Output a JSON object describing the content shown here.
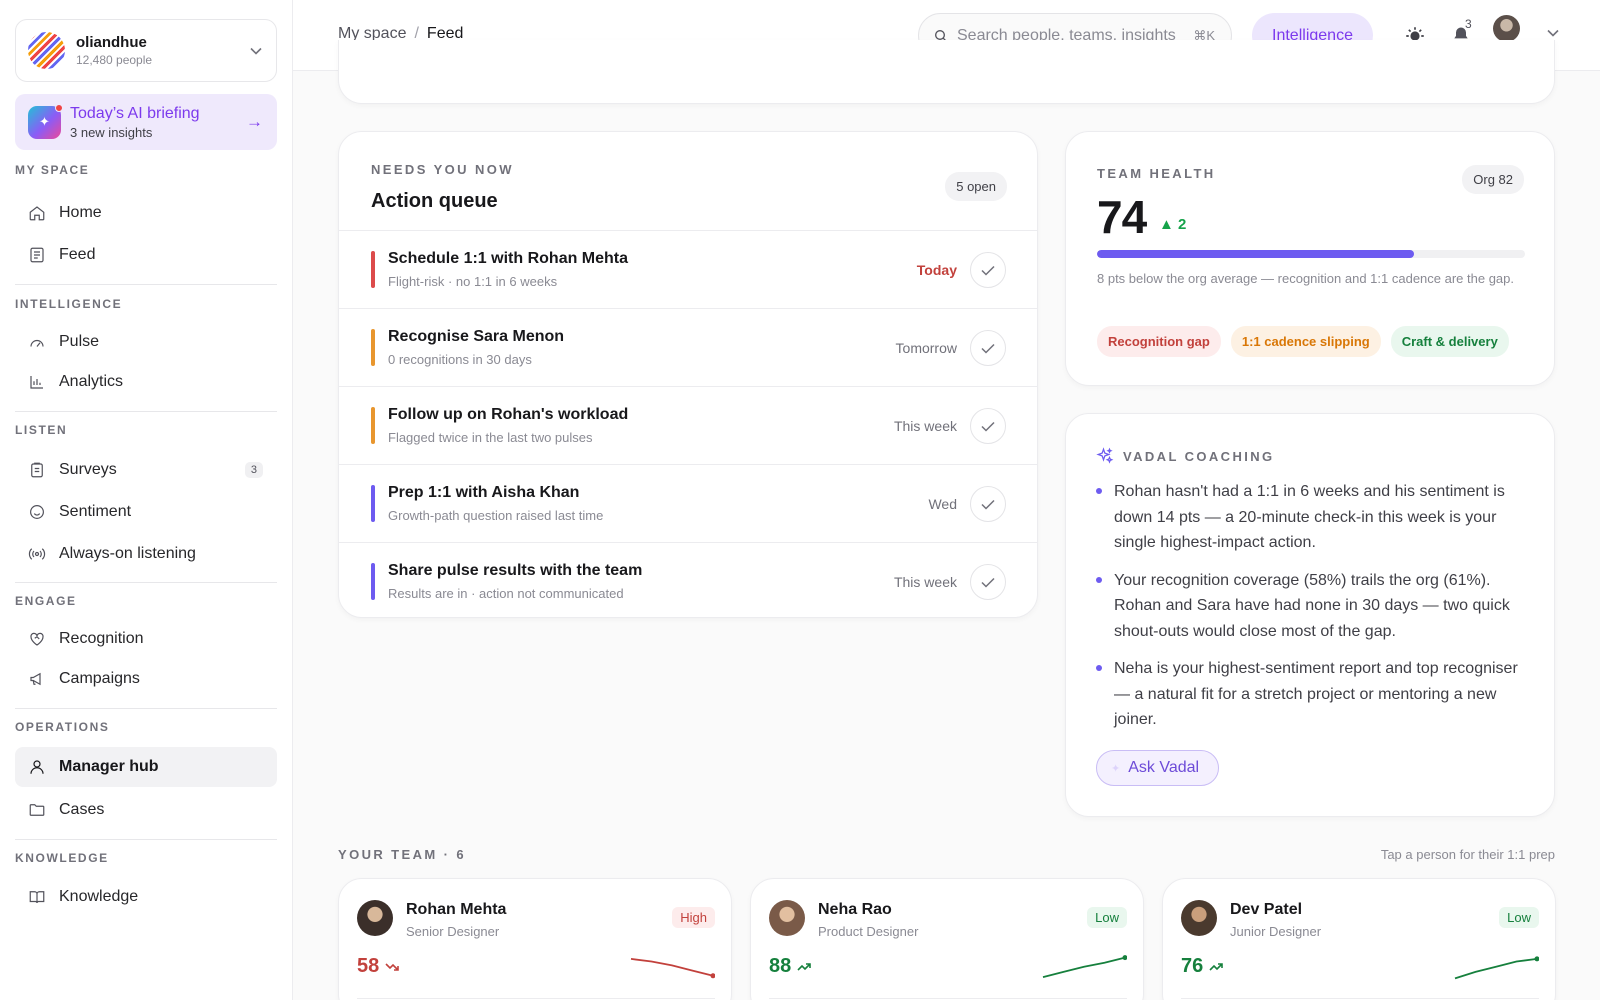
{
  "org": {
    "name": "oliandhue",
    "people": "12,480 people"
  },
  "briefing": {
    "title": "Today’s AI briefing",
    "subtitle": "3 new insights"
  },
  "nav": {
    "my_space": {
      "label": "MY SPACE",
      "items": [
        {
          "label": "Home",
          "icon": "home-icon"
        },
        {
          "label": "Feed",
          "icon": "feed-icon"
        }
      ]
    },
    "intelligence": {
      "label": "INTELLIGENCE",
      "items": [
        {
          "label": "Pulse",
          "icon": "gauge-icon"
        },
        {
          "label": "Analytics",
          "icon": "bar-chart-icon"
        }
      ]
    },
    "listen": {
      "label": "LISTEN",
      "items": [
        {
          "label": "Surveys",
          "icon": "clipboard-icon",
          "badge": "3"
        },
        {
          "label": "Sentiment",
          "icon": "smile-icon"
        },
        {
          "label": "Always-on listening",
          "icon": "broadcast-icon"
        }
      ]
    },
    "engage": {
      "label": "ENGAGE",
      "items": [
        {
          "label": "Recognition",
          "icon": "heart-handshake-icon"
        },
        {
          "label": "Campaigns",
          "icon": "megaphone-icon"
        }
      ]
    },
    "operations": {
      "label": "OPERATIONS",
      "items": [
        {
          "label": "Manager hub",
          "icon": "user-icon",
          "active": true
        },
        {
          "label": "Cases",
          "icon": "folder-icon"
        }
      ]
    },
    "knowledge": {
      "label": "KNOWLEDGE",
      "items": [
        {
          "label": "Knowledge",
          "icon": "book-icon"
        }
      ]
    }
  },
  "topbar": {
    "breadcrumb": {
      "root": "My space",
      "separator": "/",
      "current": "Feed"
    },
    "search_placeholder": "Search people, teams, insights",
    "search_shortcut": "⌘K",
    "intelligence_label": "Intelligence",
    "notifications_count": "3"
  },
  "queue": {
    "eyebrow": "NEEDS YOU NOW",
    "title": "Action queue",
    "open_count": "5 open",
    "items": [
      {
        "title": "Schedule 1:1 with Rohan Mehta",
        "subtitle": "Flight-risk · no 1:1 in 6 weeks",
        "when": "Today",
        "color": "#dc4b4b",
        "when_color": "#c2413c"
      },
      {
        "title": "Recognise Sara Menon",
        "subtitle": "0 recognitions in 30 days",
        "when": "Tomorrow",
        "color": "#e8962e",
        "when_color": "#71717a"
      },
      {
        "title": "Follow up on Rohan's workload",
        "subtitle": "Flagged twice in the last two pulses",
        "when": "This week",
        "color": "#e8962e",
        "when_color": "#71717a"
      },
      {
        "title": "Prep 1:1 with Aisha Khan",
        "subtitle": "Growth-path question raised last time",
        "when": "Wed",
        "color": "#6d5bf0",
        "when_color": "#71717a"
      },
      {
        "title": "Share pulse results with the team",
        "subtitle": "Results are in · action not communicated",
        "when": "This week",
        "color": "#6d5bf0",
        "when_color": "#71717a"
      }
    ]
  },
  "health": {
    "eyebrow": "TEAM HEALTH",
    "org_badge": "Org 82",
    "score": "74",
    "delta": "2",
    "progress": 0.74,
    "note": "8 pts below the org average — recognition and 1:1 cadence are the gap.",
    "tags": [
      {
        "label": "Recognition gap",
        "tone": "red"
      },
      {
        "label": "1:1 cadence slipping",
        "tone": "orange"
      },
      {
        "label": "Craft & delivery",
        "tone": "green"
      }
    ]
  },
  "coaching": {
    "eyebrow": "VADAL COACHING",
    "bullets": [
      "Rohan hasn't had a 1:1 in 6 weeks and his sentiment is down 14 pts — a 20-minute check-in this week is your single highest-impact action.",
      "Your recognition coverage (58%) trails the org (61%). Rohan and Sara have had none in 30 days — two quick shout-outs would close most of the gap.",
      "Neha is your highest-sentiment report and top recogniser — a natural fit for a stretch project or mentoring a new joiner."
    ],
    "ask_label": "Ask Vadal"
  },
  "team": {
    "label": "YOUR TEAM · 6",
    "hint": "Tap a person for their 1:1 prep",
    "members": [
      {
        "name": "Rohan Mehta",
        "role": "Senior Designer",
        "risk": "High",
        "risk_tone": "high",
        "score": "58",
        "trend": "down",
        "color": "#c2413c",
        "spark": [
          0.85,
          0.75,
          0.6,
          0.4,
          0.2
        ]
      },
      {
        "name": "Neha Rao",
        "role": "Product Designer",
        "risk": "Low",
        "risk_tone": "low",
        "score": "88",
        "trend": "up",
        "color": "#16803d",
        "spark": [
          0.15,
          0.35,
          0.55,
          0.7,
          0.9
        ]
      },
      {
        "name": "Dev Patel",
        "role": "Junior Designer",
        "risk": "Low",
        "risk_tone": "low",
        "score": "76",
        "trend": "up",
        "color": "#16803d",
        "spark": [
          0.1,
          0.35,
          0.55,
          0.75,
          0.85
        ]
      }
    ]
  }
}
